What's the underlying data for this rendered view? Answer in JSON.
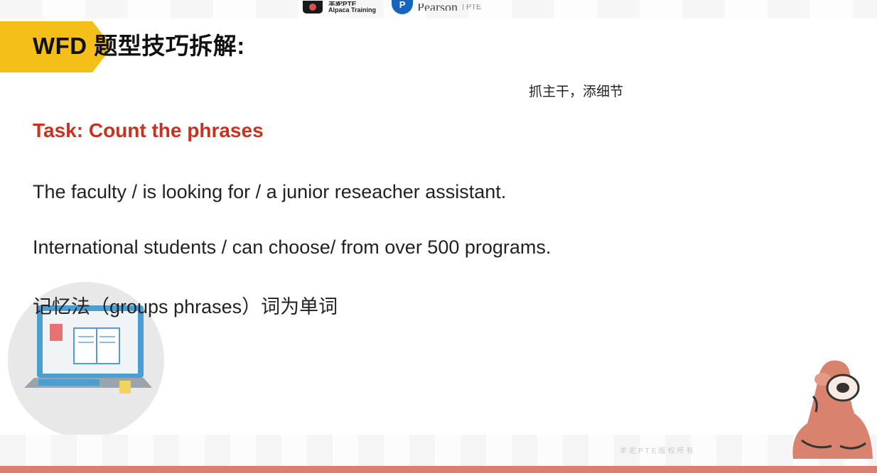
{
  "header": {
    "alpaca_logo_cn": "羊驼PTE",
    "alpaca_logo_en": "Alpaca Training",
    "pearson_logo": "Pearson",
    "pearson_sub": "| PTE"
  },
  "slide": {
    "title": "WFD 题型技巧拆解:",
    "tip": "抓主干，添细节",
    "task": "Task: Count the phrases",
    "lines": [
      "The faculty / is looking for / a junior reseacher assistant.",
      "International students / can choose/ from over 500 programs.",
      "记忆法（groups phrases）词为单词"
    ]
  },
  "footer": {
    "watermark": "羊驼PTE版权所有"
  },
  "colors": {
    "banner": "#f5bf19",
    "task_red": "#c8321e",
    "bottom_strip": "#d97f73"
  }
}
